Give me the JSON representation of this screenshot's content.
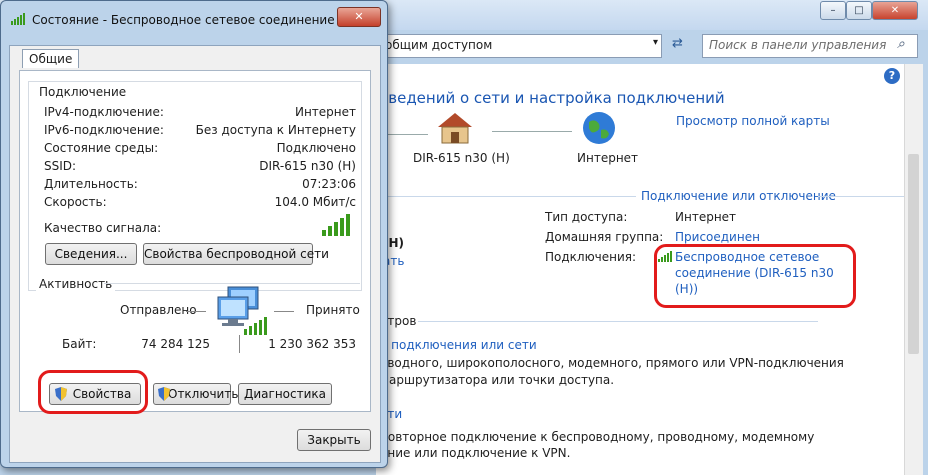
{
  "background_window": {
    "address_text": "общим доступом",
    "search_placeholder": "Поиск в панели управления",
    "heading": "сведений о сети и настройка подключений",
    "view_full_map": "Просмотр полной карты",
    "node_router": "DIR-615 n30 (H)",
    "node_internet": "Интернет",
    "connect_disconnect": "Подключение или отключение",
    "access_type_label": "Тип доступа:",
    "access_type_value": "Интернет",
    "homegroup_label": "Домашняя группа:",
    "homegroup_value": "Присоединен",
    "connections_label": "Подключения:",
    "connection_link": "Беспроводное сетевое соединение (DIR-615 n30 (H))",
    "partial_network_name": "(H)",
    "partial_link": "ать",
    "partial_params": "етров",
    "setup_link": "о подключения или сети",
    "setup_desc_1": "оводного, широкополосного, модемного, прямого или VPN-подключения",
    "setup_desc_2": "маршрутизатора или точки доступа.",
    "partial_network_link": "ети",
    "reconnect_desc_1": "повторное подключение к беспроводному, проводному, модемному",
    "reconnect_desc_2": "ение или подключение к VPN."
  },
  "dialog": {
    "title": "Состояние - Беспроводное сетевое соединение",
    "tab_general": "Общие",
    "section_connection": "Подключение",
    "rows": [
      {
        "label": "IPv4-подключение:",
        "value": "Интернет"
      },
      {
        "label": "IPv6-подключение:",
        "value": "Без доступа к Интернету"
      },
      {
        "label": "Состояние среды:",
        "value": "Подключено"
      },
      {
        "label": "SSID:",
        "value": "DIR-615 n30 (H)"
      },
      {
        "label": "Длительность:",
        "value": "07:23:06"
      },
      {
        "label": "Скорость:",
        "value": "104.0 Мбит/с"
      }
    ],
    "signal_label": "Качество сигнала:",
    "signal_bars": 5,
    "details_button": "Сведения...",
    "wireless_props_button": "Свойства беспроводной сети",
    "section_activity": "Активность",
    "sent_label": "Отправлено",
    "received_label": "Принято",
    "bytes_label": "Байт:",
    "bytes_sent": "74 284 125",
    "bytes_received": "1 230 362 353",
    "properties_button": "Свойства",
    "disconnect_button": "Отключить",
    "diagnostics_button": "Диагностика",
    "close_button": "Закрыть"
  },
  "colors": {
    "highlight_red": "#e21b1b",
    "link_blue": "#1f5fbf",
    "signal_green": "#3a9a1c"
  }
}
